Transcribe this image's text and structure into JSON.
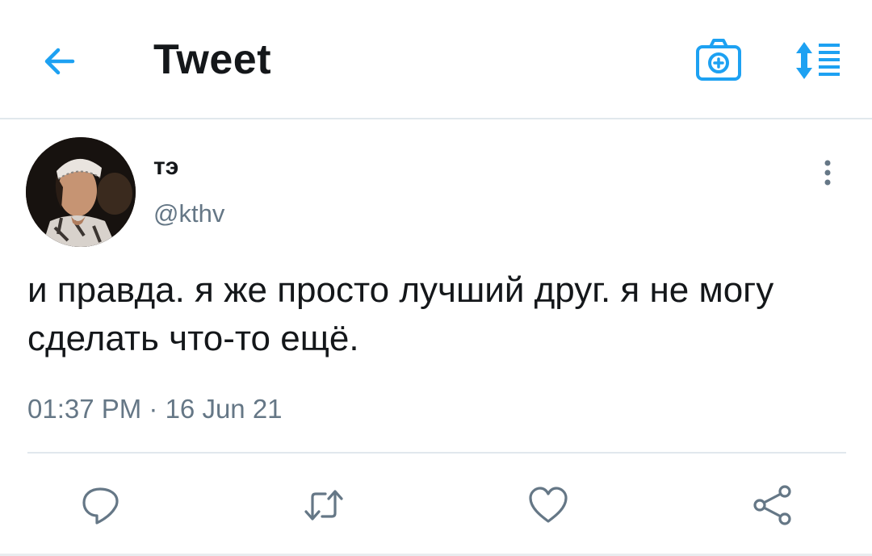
{
  "header": {
    "title": "Tweet",
    "icons": [
      "back-arrow-icon",
      "camera-add-icon",
      "sort-list-icon"
    ]
  },
  "tweet": {
    "display_name": "тэ",
    "handle": "@kthv",
    "text": "и правда. я же просто лучший друг. я не могу сделать что-то ещё.",
    "timestamp": "01:37 PM · 16 Jun 21"
  },
  "actions": [
    "reply-icon",
    "retweet-icon",
    "like-icon",
    "share-icon"
  ],
  "colors": {
    "accent": "#1da1f2",
    "text": "#14171a",
    "secondary_text": "#657786",
    "divider": "#e1e8ed"
  }
}
